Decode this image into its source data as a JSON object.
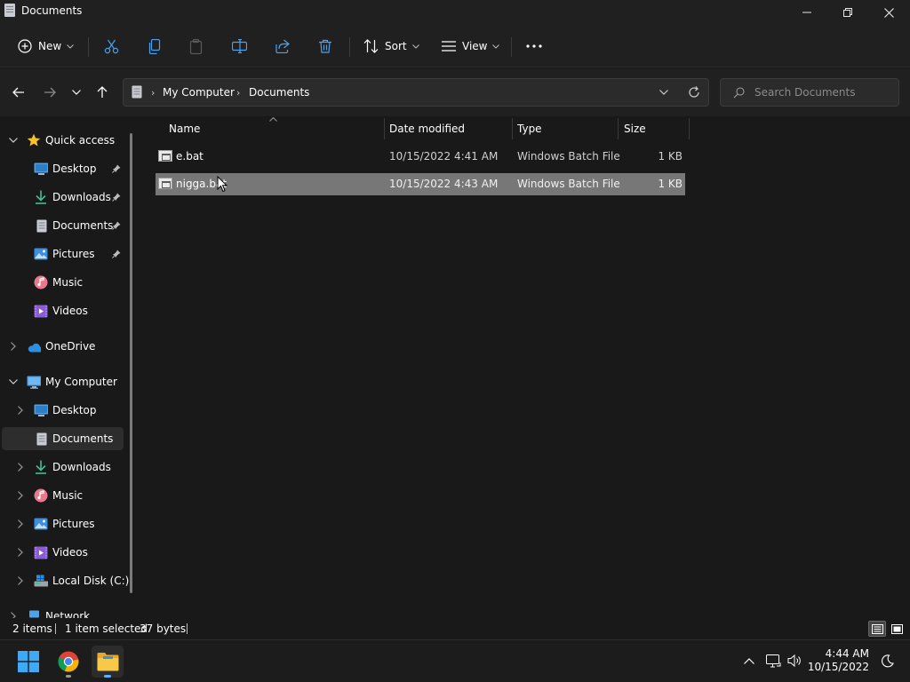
{
  "window": {
    "title": "Documents",
    "controls": {
      "minimize": "minimize",
      "maximize": "restore",
      "close": "close"
    }
  },
  "toolbar": {
    "new_label": "New",
    "sort_label": "Sort",
    "view_label": "View",
    "icons": [
      "add-icon",
      "cut-icon",
      "copy-icon",
      "paste-icon",
      "rename-icon",
      "share-icon",
      "delete-icon",
      "sort-icon",
      "view-icon",
      "more-icon"
    ]
  },
  "address": {
    "crumbs": [
      "My Computer",
      "Documents"
    ],
    "search_placeholder": "Search Documents"
  },
  "nav": {
    "quick_access": {
      "label": "Quick access",
      "items": [
        {
          "label": "Desktop",
          "icon": "desktop-icon",
          "pinned": true
        },
        {
          "label": "Downloads",
          "icon": "download-icon",
          "pinned": true
        },
        {
          "label": "Documents",
          "icon": "document-icon",
          "pinned": true
        },
        {
          "label": "Pictures",
          "icon": "pictures-icon",
          "pinned": true
        },
        {
          "label": "Music",
          "icon": "music-icon",
          "pinned": false
        },
        {
          "label": "Videos",
          "icon": "videos-icon",
          "pinned": false
        }
      ]
    },
    "onedrive": {
      "label": "OneDrive"
    },
    "my_computer": {
      "label": "My Computer",
      "items": [
        {
          "label": "Desktop"
        },
        {
          "label": "Documents",
          "selected": true
        },
        {
          "label": "Downloads"
        },
        {
          "label": "Music"
        },
        {
          "label": "Pictures"
        },
        {
          "label": "Videos"
        },
        {
          "label": "Local Disk (C:)"
        }
      ]
    },
    "network": {
      "label": "Network"
    }
  },
  "files": {
    "columns": {
      "name": "Name",
      "date": "Date modified",
      "type": "Type",
      "size": "Size"
    },
    "sorted_by": "Name",
    "rows": [
      {
        "name": "e.bat",
        "date": "10/15/2022 4:41 AM",
        "type": "Windows Batch File",
        "size": "1 KB",
        "selected": false
      },
      {
        "name": "nigga.bat",
        "date": "10/15/2022 4:43 AM",
        "type": "Windows Batch File",
        "size": "1 KB",
        "selected": true
      }
    ]
  },
  "status": {
    "item_count": "2 items",
    "selection": "1 item selected",
    "selection_size": "37 bytes"
  },
  "taskbar": {
    "apps": [
      "start-icon",
      "chrome-icon",
      "file-explorer-icon"
    ],
    "time": "4:44 AM",
    "date": "10/15/2022"
  },
  "colors": {
    "background": "#191919",
    "chrome": "#202020",
    "selected_row": "#777777",
    "accent": "#0078d4"
  }
}
